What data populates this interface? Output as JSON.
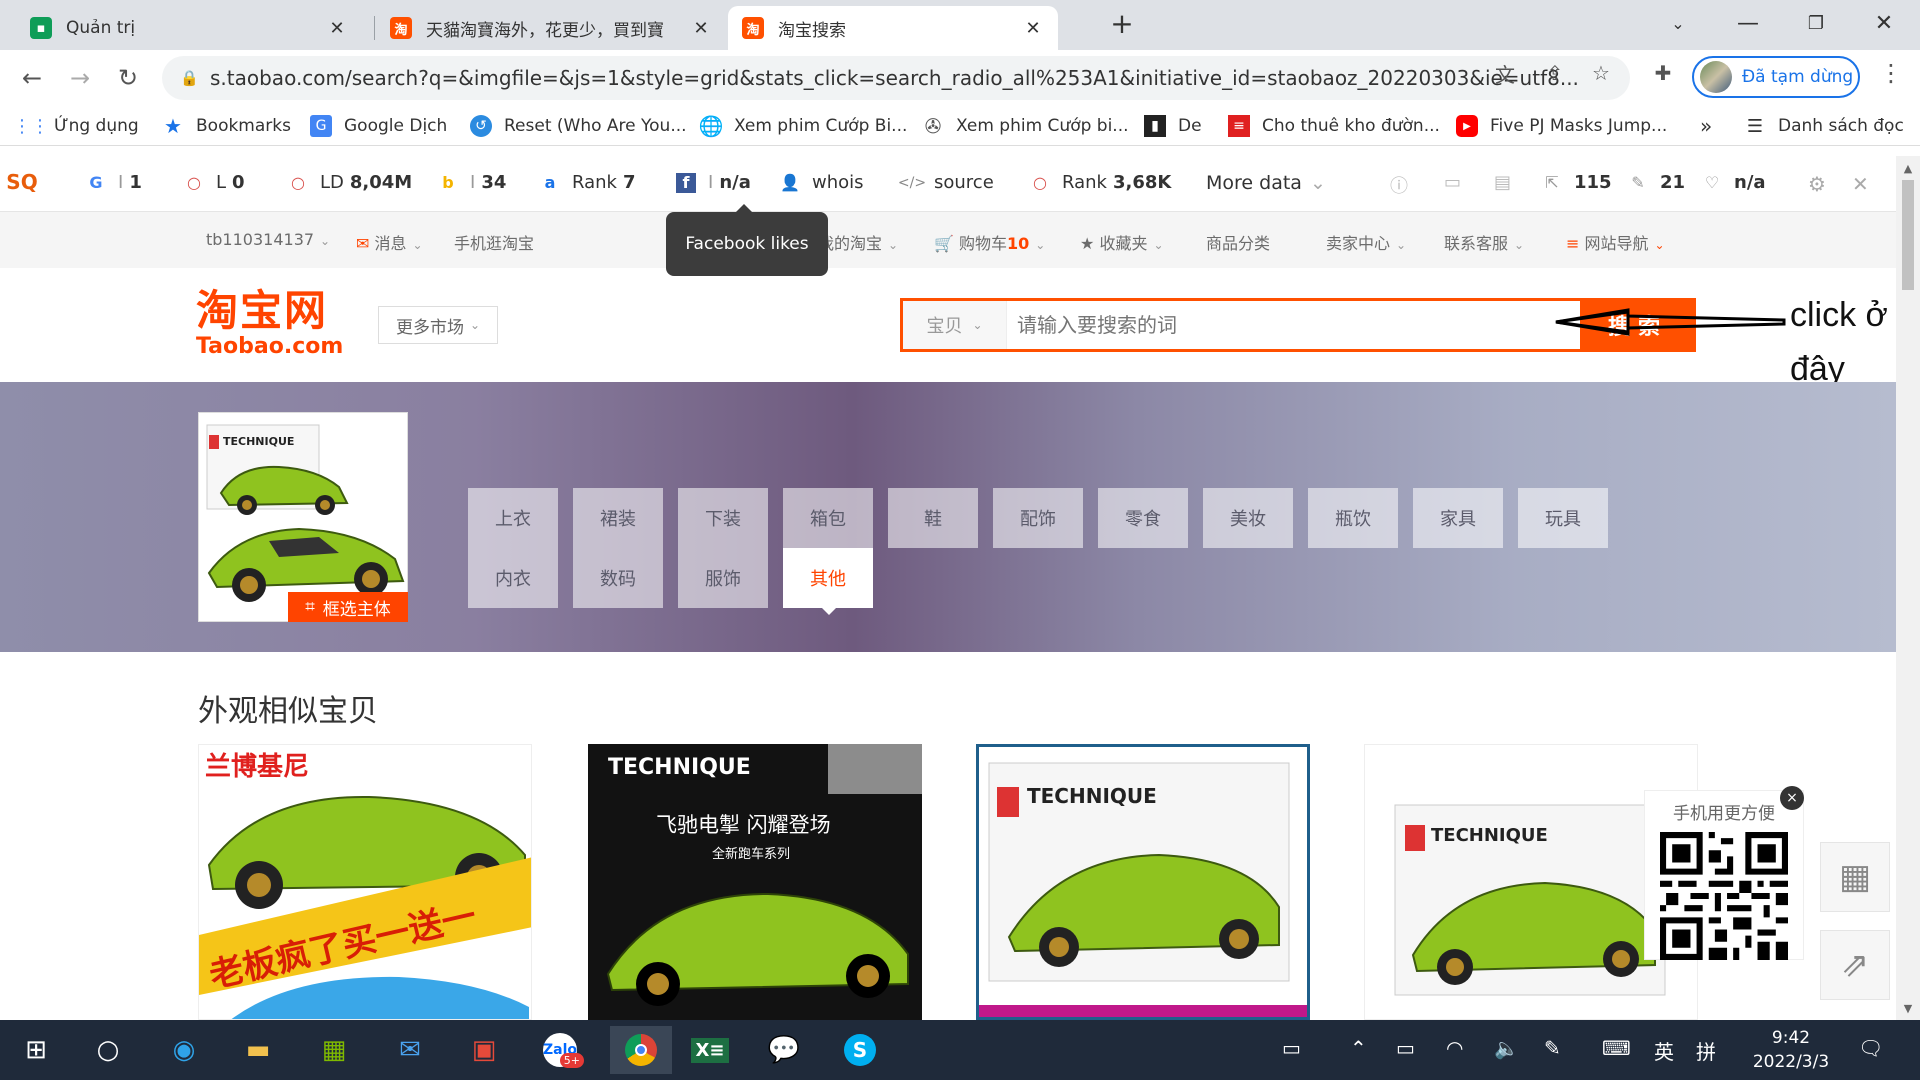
{
  "browser": {
    "tabs": [
      {
        "title": "Quản trị",
        "favicon": "green-square-icon",
        "color": "#0f9d58"
      },
      {
        "title": "天貓淘寶海外，花更少，買到寶",
        "favicon": "taobao-icon",
        "color": "#ff5000"
      },
      {
        "title": "淘宝搜索",
        "favicon": "taobao-icon",
        "color": "#ff5000"
      }
    ],
    "new_tab": "+",
    "url": "s.taobao.com/search?q=&imgfile=&js=1&style=grid&stats_click=search_radio_all%253A1&initiative_id=staobaoz_20220303&ie=utf8...",
    "profile_label": "Đã tạm dừng",
    "bookmarks": [
      {
        "label": "Ứng dụng",
        "icon": "apps-grid-icon"
      },
      {
        "label": "Bookmarks",
        "icon": "star-icon"
      },
      {
        "label": "Google Dịch",
        "icon": "google-translate-icon"
      },
      {
        "label": "Reset (Who Are You...",
        "icon": "reset-icon"
      },
      {
        "label": "Xem phim Cướp Bi...",
        "icon": "globe-icon"
      },
      {
        "label": "Xem phim Cướp bi...",
        "icon": "film-icon"
      },
      {
        "label": "De",
        "icon": "dark-square-icon"
      },
      {
        "label": "Cho thuê kho đườn...",
        "icon": "red-logo-icon"
      },
      {
        "label": "Five PJ Masks Jump...",
        "icon": "youtube-icon"
      }
    ],
    "more_bookmarks": "»",
    "reading_list": "Danh sách đọc"
  },
  "seo_toolbar": {
    "items": [
      {
        "icon": "google-icon",
        "label": "I",
        "value": "1"
      },
      {
        "icon": "circle-icon",
        "label": "L",
        "value": "0"
      },
      {
        "icon": "circle-icon",
        "label": "LD",
        "value": "8,04M"
      },
      {
        "icon": "bing-icon",
        "label": "I",
        "value": "34"
      },
      {
        "icon": "alexa-icon",
        "label": "Rank",
        "value": "7"
      },
      {
        "icon": "facebook-icon",
        "label": "I",
        "value": "n/a"
      },
      {
        "icon": "person-icon",
        "label": "whois",
        "value": ""
      },
      {
        "icon": "code-icon",
        "label": "source",
        "value": ""
      },
      {
        "icon": "circle-icon",
        "label": "Rank",
        "value": "3,68K"
      }
    ],
    "more_data": "More data",
    "stats": [
      {
        "icon": "external-link-icon",
        "value": "115"
      },
      {
        "icon": "edit-link-icon",
        "value": "21"
      },
      {
        "icon": "shield-icon",
        "value": "n/a"
      }
    ],
    "tooltip": "Facebook likes"
  },
  "taobao_nav": {
    "user": "tb110314137",
    "messages": "消息",
    "mobile": "手机逛淘宝",
    "my_taobao": "我的淘宝",
    "cart_label": "购物车",
    "cart_count": "10",
    "favorites": "收藏夹",
    "categories": "商品分类",
    "seller": "卖家中心",
    "service": "联系客服",
    "sitemap": "网站导航"
  },
  "header": {
    "logo_cn": "淘宝网",
    "logo_en": "Taobao.com",
    "more_markets": "更多市场",
    "search_category": "宝贝",
    "search_placeholder": "请输入要搜索的词",
    "search_button": "搜索",
    "annotation": "click ở đây"
  },
  "image_search": {
    "thumb_brand": "TECHNIQUE",
    "crop_label": "框选主体",
    "category_buttons": [
      [
        "上衣",
        "内衣"
      ],
      [
        "裙装",
        "数码"
      ],
      [
        "下装",
        "服饰"
      ],
      [
        "箱包",
        "其他"
      ],
      [
        "鞋"
      ],
      [
        "配饰"
      ],
      [
        "零食"
      ],
      [
        "美妆"
      ],
      [
        "瓶饮"
      ],
      [
        "家具"
      ],
      [
        "玩具"
      ]
    ],
    "selected": "其他"
  },
  "results": {
    "section_title": "外观相似宝贝",
    "cards": [
      {
        "text_top": "兰博基尼",
        "text_promo": "老板疯了买一送一"
      },
      {
        "text_top": "TECHNIQUE",
        "sub": "飞驰电掣 闪耀登场",
        "sub2": "全新跑车系列"
      },
      {
        "text_top": "TECHNIQUE"
      },
      {
        "text_top": "TECHNIQUE"
      }
    ]
  },
  "qr_popup": {
    "title": "手机用更方便",
    "close": "×"
  },
  "taskbar": {
    "time": "9:42",
    "date": "2022/3/3",
    "ime": "英",
    "zalo_badge": "5+"
  },
  "colors": {
    "taobao_orange": "#ff5000",
    "taobao_red": "#ff4400",
    "car_green": "#8fc31f"
  }
}
